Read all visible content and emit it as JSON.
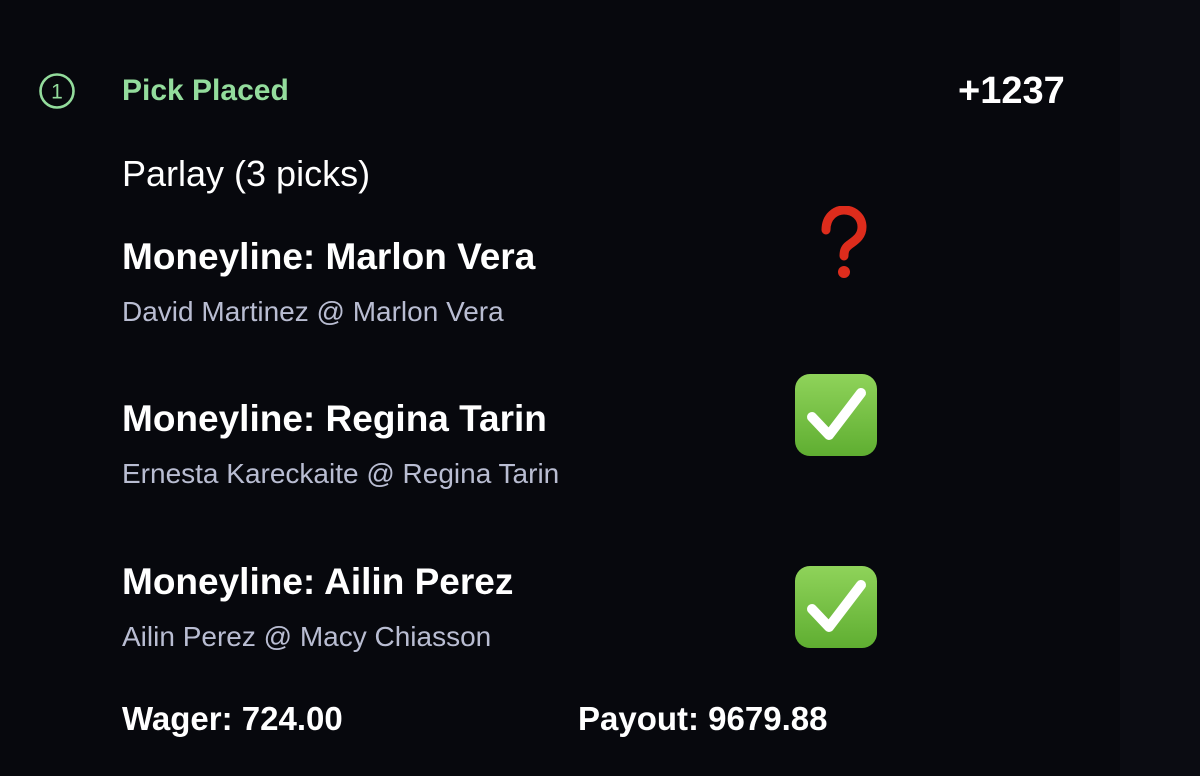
{
  "header": {
    "step_number": "1",
    "status": "Pick Placed",
    "odds": "+1237"
  },
  "bet": {
    "type": "Parlay (3 picks)"
  },
  "picks": [
    {
      "title": "Moneyline: Marlon Vera",
      "matchup": "David Martinez @ Marlon Vera",
      "result_icon": "red-question-mark-icon"
    },
    {
      "title": "Moneyline: Regina Tarin",
      "matchup": "Ernesta Kareckaite @ Regina Tarin",
      "result_icon": "green-check-icon"
    },
    {
      "title": "Moneyline: Ailin Perez",
      "matchup": "Ailin Perez @ Macy Chiasson",
      "result_icon": "green-check-icon"
    }
  ],
  "footer": {
    "wager": "Wager: 724.00",
    "payout": "Payout: 9679.88"
  },
  "colors": {
    "background": "#07080d",
    "status_green": "#93dc9c",
    "check_green": "#76c043",
    "question_red": "#dd2c1c",
    "secondary_text": "#b9bdd2"
  }
}
